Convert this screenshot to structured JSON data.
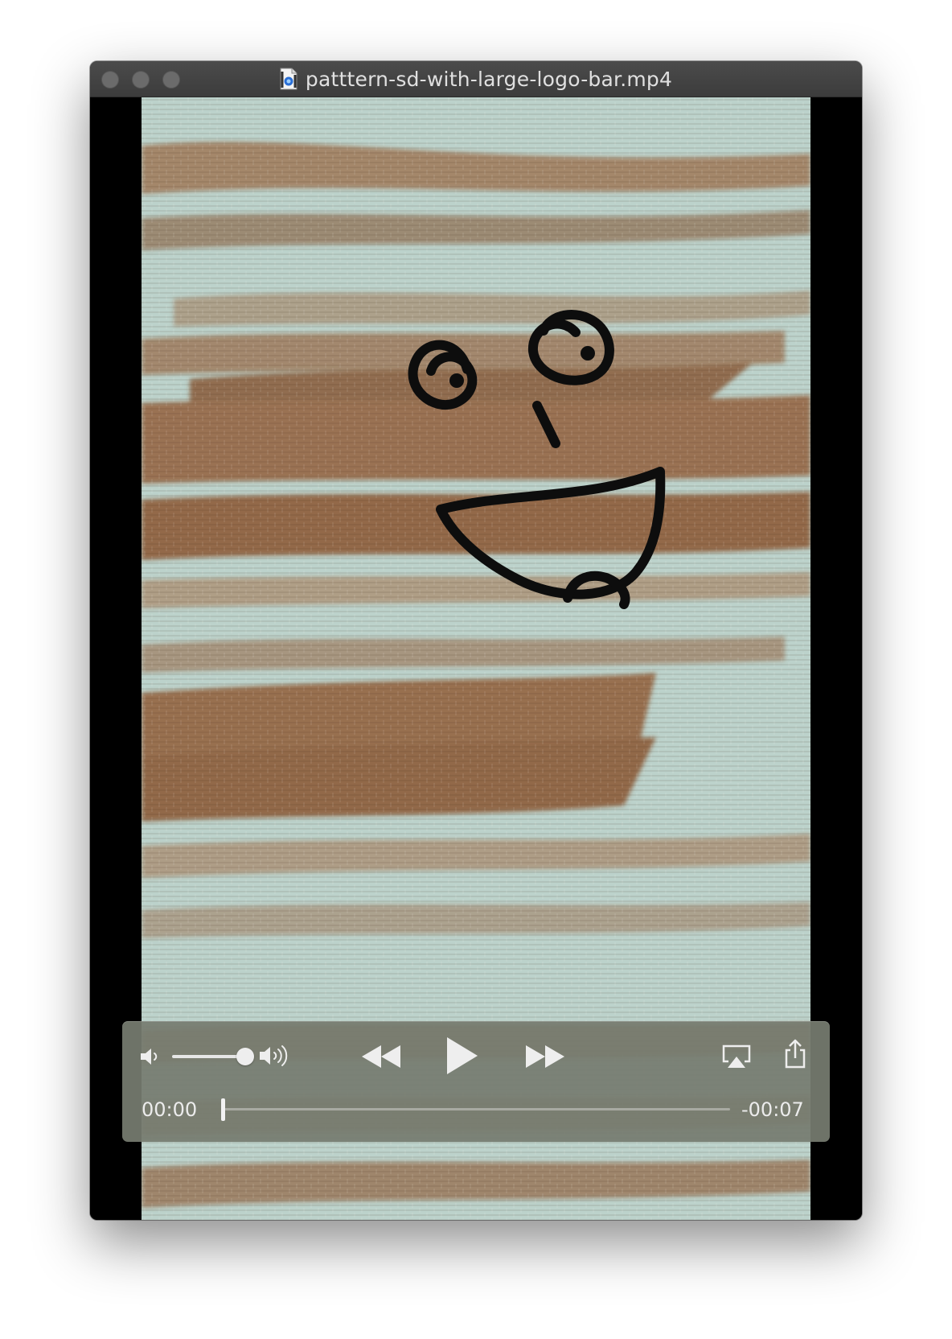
{
  "window": {
    "title": "patttern-sd-with-large-logo-bar.mp4",
    "file_icon": "quicktime-document-icon"
  },
  "player": {
    "current_time": "00:00",
    "remaining_time": "-00:07",
    "volume_level": 0.85,
    "playback_progress": 0.0,
    "state": "paused"
  },
  "icons": {
    "volume_low": "speaker-low-icon",
    "volume_high": "speaker-high-icon",
    "rewind": "rewind-icon",
    "play": "play-icon",
    "fast_forward": "fast-forward-icon",
    "airplay": "airplay-icon",
    "share": "share-icon"
  },
  "colors": {
    "titlebar": "#404040",
    "controls_bg": "#767c70",
    "wood_light": "#b8cfc9",
    "wood_dark": "#9a7556"
  }
}
